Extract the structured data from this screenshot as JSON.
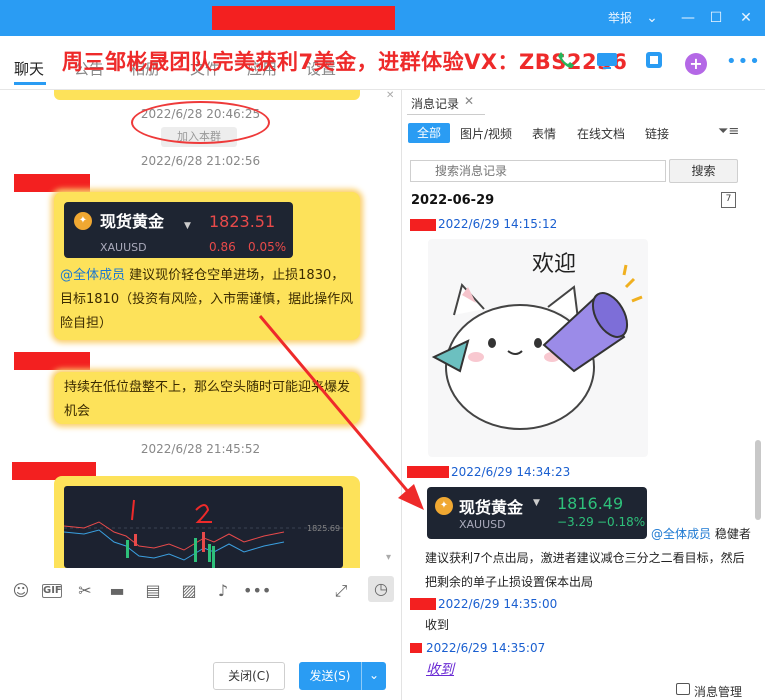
{
  "titlebar": {
    "report_label": "举报",
    "minimize": "—",
    "maximize": "☐",
    "close": "✕",
    "dropdown": "⌄"
  },
  "tabs": [
    {
      "label": "聊天"
    },
    {
      "label": "公告"
    },
    {
      "label": "相册"
    },
    {
      "label": "文件"
    },
    {
      "label": "应用"
    },
    {
      "label": "设置"
    }
  ],
  "overlay_banner": "周三邹彬晟团队完美获利7美金，进群体验VX：ZBS2256",
  "toolbar_icons": {
    "plus": "+",
    "more": "•••"
  },
  "chat": {
    "timestamps": [
      "2022/6/28 20:46:25",
      "2022/6/28 21:02:56",
      "2022/6/28 21:45:52"
    ],
    "join_tag": "加入本群",
    "gold_card_1": {
      "name": "现货黄金",
      "code": "XAUUSD",
      "price": "1823.51",
      "change": "0.86",
      "change_pct": "0.05%"
    },
    "msg_1": {
      "mention": "@全体成员",
      "text": " 建议现价轻仓空单进场，止损1830，目标1810（投资有风险，入市需谨慎，据此操作风险自担）"
    },
    "msg_2": "持续在低位盘整不上，那么空头随时可能迎来爆发机会",
    "chart_price_label": "1825.69"
  },
  "input_tools": {
    "gif": "GIF",
    "more": "•••"
  },
  "buttons": {
    "close": "关闭(C)",
    "send": "发送(S)",
    "send_arrow": "⌄"
  },
  "right_panel": {
    "title": "消息记录",
    "filters": [
      "全部",
      "图片/视频",
      "表情",
      "在线文档",
      "链接"
    ],
    "search_placeholder": "搜索消息记录",
    "search_button": "搜索",
    "date": "2022-06-29",
    "cal_day": "7",
    "records": [
      {
        "time": "2022/6/29 14:15:12"
      },
      {
        "time": "2022/6/29 14:34:23"
      },
      {
        "time": "2022/6/29 14:35:00",
        "text": "收到"
      },
      {
        "time": "2022/6/29 14:35:07"
      }
    ],
    "sticker_caption": "欢迎",
    "gold_card_2": {
      "name": "现货黄金",
      "code": "XAUUSD",
      "price": "1816.49",
      "change": "−3.29",
      "change_pct": "−0.18%"
    },
    "mention_msg": {
      "mention": "@全体成员",
      "text": " 稳健者建议获利7个点出局，激进者建议减仓三分之二看目标，然后把剩余的单子止损设置保本出局"
    },
    "last_reply": "收到",
    "manage_label": "消息管理"
  },
  "colors": {
    "accent": "#2a9cf3",
    "bubble": "#fde25a",
    "price_up": "#e84a4a",
    "price_down": "#2ec07a",
    "annotation_red": "#ee2a2a"
  }
}
